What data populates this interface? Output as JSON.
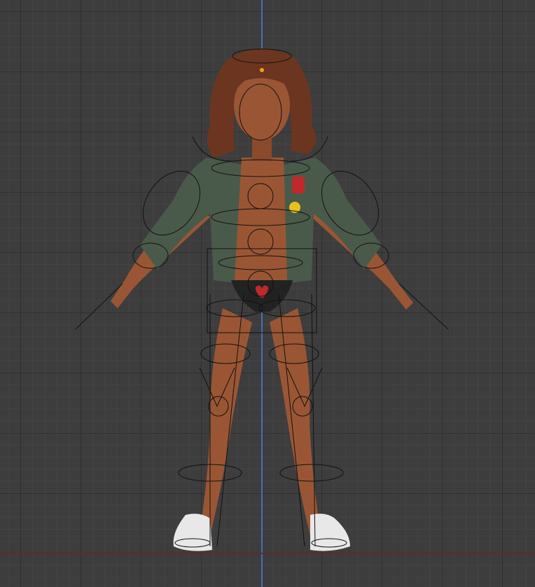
{
  "viewport": {
    "kind": "3d-viewport-front-orthographic",
    "background_color": "#3d3d3d",
    "grid_color": "#2e2e2e",
    "axis_z_color": "#4a78c8",
    "ground_color": "#5a2d2d"
  },
  "character": {
    "skin_color": "#9a5634",
    "hair_color": "#6b3520",
    "jacket_color": "#4a5a4a",
    "underwear_color": "#222222",
    "patch_red": "#c0282a",
    "smiley_yellow": "#e8c21a",
    "shoe_color": "#e8e8e8",
    "rig_line_color": "#111111",
    "origin_marker_color": "#f2a11a"
  }
}
